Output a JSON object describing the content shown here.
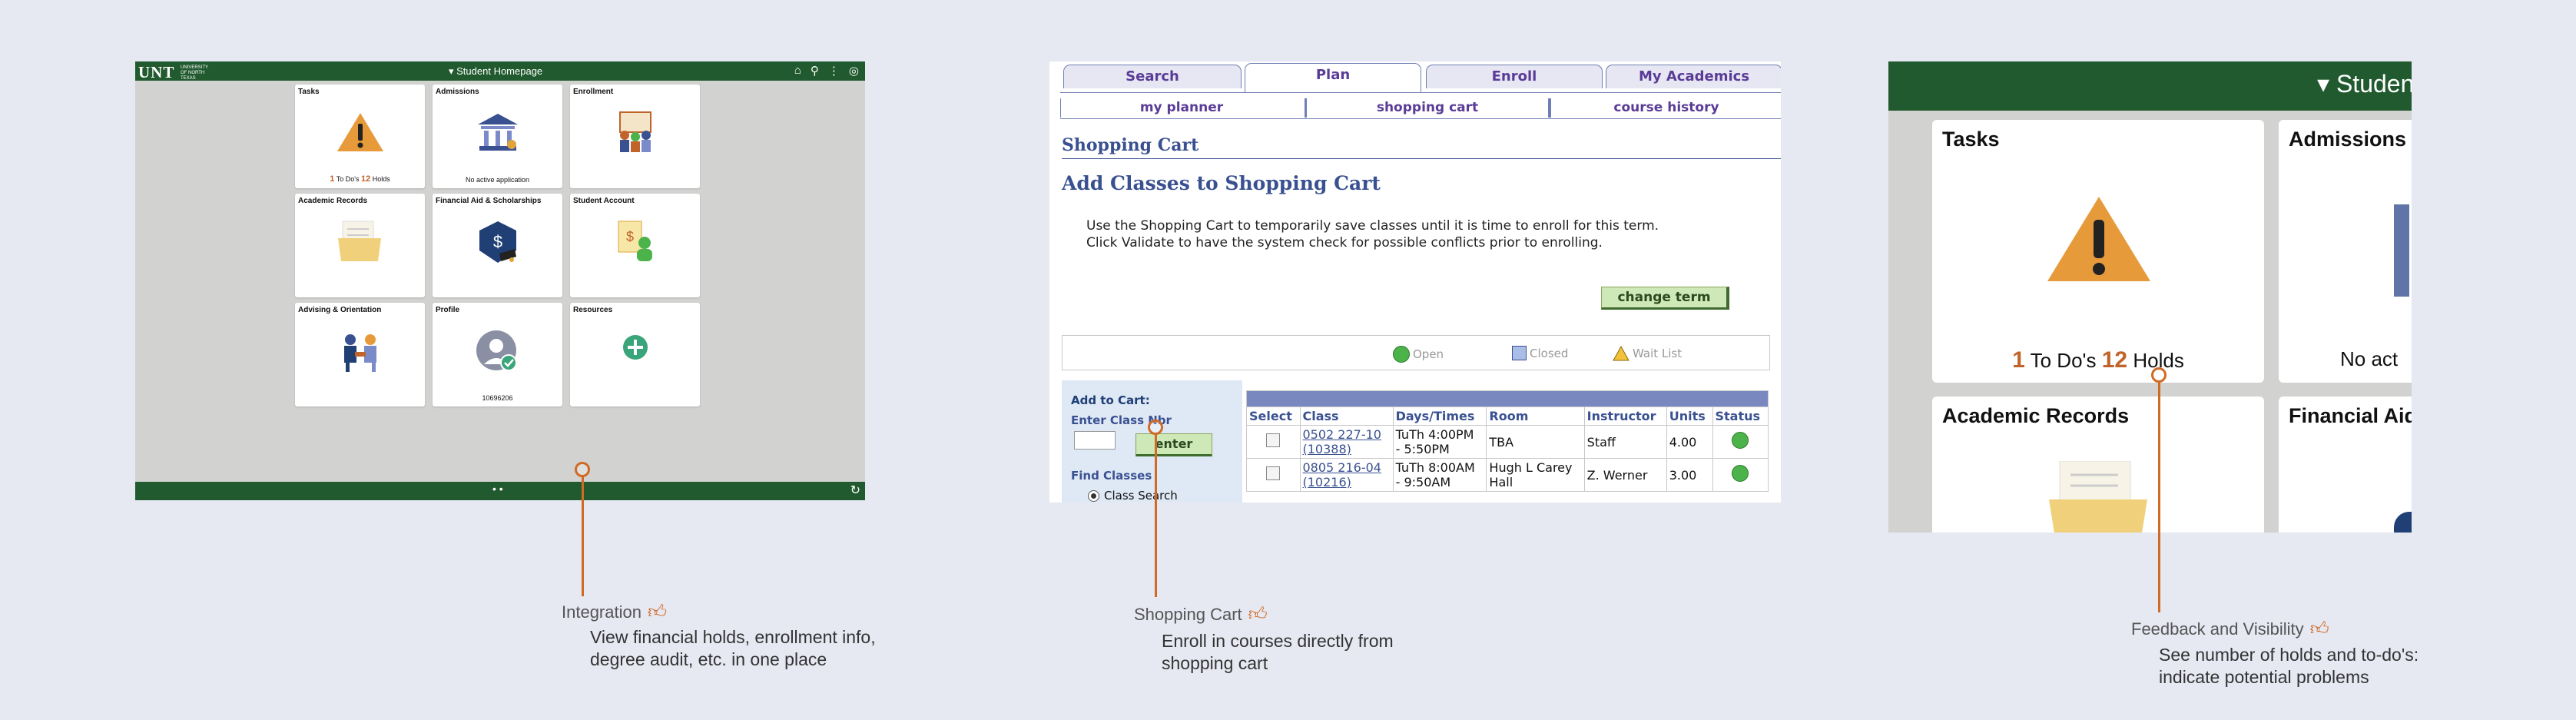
{
  "panel1": {
    "logo": "UNT",
    "logo_sub": "UNIVERSITY OF NORTH TEXAS",
    "title": "▾ Student Homepage",
    "tiles": [
      {
        "title": "Tasks",
        "footer_count1": "1",
        "footer_label1": "To Do's",
        "footer_count2": "12",
        "footer_label2": "Holds"
      },
      {
        "title": "Admissions",
        "footer": "No active application"
      },
      {
        "title": "Enrollment"
      },
      {
        "title": "Academic Records"
      },
      {
        "title": "Financial Aid & Scholarships"
      },
      {
        "title": "Student Account"
      },
      {
        "title": "Advising & Orientation"
      },
      {
        "title": "Profile",
        "footer": "10696206"
      },
      {
        "title": "Resources"
      }
    ],
    "pager": "• •"
  },
  "panel2": {
    "tabs": [
      "Search",
      "Plan",
      "Enroll",
      "My Academics"
    ],
    "active_tab": "Plan",
    "subtabs": [
      "my planner",
      "shopping cart",
      "course history"
    ],
    "heading": "Shopping Cart",
    "subheading": "Add Classes to Shopping Cart",
    "intro_line1": "Use the Shopping Cart to temporarily save classes until it is time to enroll for this term.",
    "intro_line2": "Click Validate to have the system check for possible conflicts prior to enrolling.",
    "change_term": "change term",
    "legend": {
      "open": "Open",
      "closed": "Closed",
      "wait": "Wait List"
    },
    "add_to_cart": "Add to Cart:",
    "enter_class_nbr": "Enter Class Nbr",
    "enter_button": "enter",
    "find_classes": "Find Classes",
    "class_search": "Class Search",
    "table": {
      "headers": [
        "Select",
        "Class",
        "Days/Times",
        "Room",
        "Instructor",
        "Units",
        "Status"
      ],
      "rows": [
        {
          "class": "0502 227-10",
          "class_nbr": "(10388)",
          "days1": "TuTh 4:00PM",
          "days2": "- 5:50PM",
          "room": "TBA",
          "room2": "",
          "instructor": "Staff",
          "units": "4.00"
        },
        {
          "class": "0805 216-04",
          "class_nbr": "(10216)",
          "days1": "TuTh 8:00AM",
          "days2": "- 9:50AM",
          "room": "Hugh L Carey",
          "room2": "Hall",
          "instructor": "Z. Werner",
          "units": "3.00"
        }
      ]
    }
  },
  "panel3": {
    "title": "▾ Studen",
    "tiles": [
      {
        "title": "Tasks",
        "footer_count1": "1",
        "footer_label1": "To Do's",
        "footer_count2": "12",
        "footer_label2": "Holds"
      },
      {
        "title": "Admissions",
        "footer": "No act"
      },
      {
        "title": "Academic Records"
      },
      {
        "title": "Financial Aid"
      }
    ]
  },
  "annotations": [
    {
      "title": "Integration",
      "text": "View financial holds, enrollment info, degree audit, etc. in one place"
    },
    {
      "title": "Shopping Cart",
      "text": "Enroll in courses directly from shopping cart"
    },
    {
      "title": "Feedback and Visibility",
      "text": "See number of holds and to-do's: indicate potential problems"
    }
  ],
  "colors": {
    "unt_green": "#215a2e",
    "accent_orange": "#d06a25",
    "psft_blue": "#3a5191",
    "psft_purple": "#5a3c97"
  }
}
